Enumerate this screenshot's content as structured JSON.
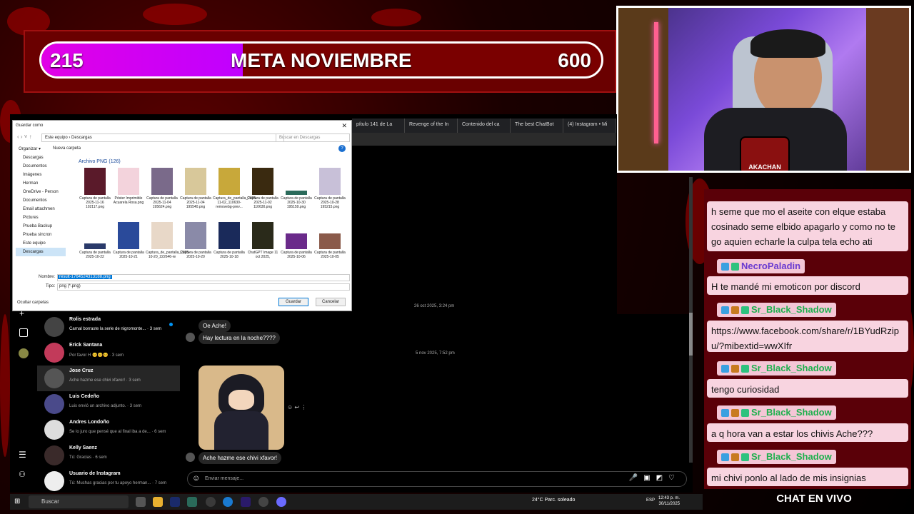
{
  "goal": {
    "current": "215",
    "label": "META NOVIEMBRE",
    "target": "600",
    "progress_fraction": 0.36
  },
  "colors": {
    "goal_fill": "#e100e6",
    "chat_bg": "#5a0008",
    "message_bg": "#f8d4e0",
    "username": "#1db04d"
  },
  "chat": {
    "title": "CHAT EN VIVO",
    "messages": [
      {
        "user": "",
        "text": "h seme que mo el aseite con elque estaba cosinado seme elbido apagarlo y como no te go aquien echarle la culpa tela echo ati"
      },
      {
        "user": "NecroPaladin",
        "text": "H te mandé mi emoticon por discord"
      },
      {
        "user": "Sr_Black_Shadow",
        "text": "https://www.facebook.com/share/r/1BYudRzipu/?mibextid=wwXIfr"
      },
      {
        "user": "Sr_Black_Shadow",
        "text": "tengo curiosidad"
      },
      {
        "user": "Sr_Black_Shadow",
        "text": "a q hora van a estar los chivis Ache???"
      },
      {
        "user": "Sr_Black_Shadow",
        "text": "mi chivi ponlo al lado de mis insignias"
      }
    ]
  },
  "cam": {
    "logo_text": "AKACHAN"
  },
  "browser": {
    "tabs": [
      "pítulo 141 de La",
      "Revenge of the In",
      "Contenido del ca",
      "The best ChatBot",
      "(4) Instagram • Mi"
    ]
  },
  "dialog": {
    "title": "Guardar como",
    "path": "Este equipo › Descargas",
    "search_placeholder": "Buscar en Descargas",
    "organize": "Organizar ▾",
    "new_folder": "Nueva carpeta",
    "sidebar": [
      "Descargas",
      "Documentos",
      "Imágenes",
      "Herman",
      "OneDrive - Person",
      "Documentos",
      "Email attachmen",
      "Pictures",
      "Prueba Backup",
      "Prueba sincron",
      "Este equipo",
      "Descargas"
    ],
    "group_label": "Archivo PNG (126)",
    "files_row1": [
      "Captura de pantalla 2025-11-16 102117.png",
      "Póster Imprimible Acuarela Rosa.png",
      "Captura de pantalla 2025-11-04 195624.png",
      "Captura de pantalla 2025-11-04 195540.png",
      "Captura_de_pantalla_2025-11-02_110630-removebg-prev...",
      "Captura de pantalla 2025-11-02 110630.png",
      "Captura de pantalla 2025-10-30 195159.png",
      "Captura de pantalla 2025-10-28 195215.png"
    ],
    "files_row2": [
      "Captura de pantalla 2025-10-22",
      "Captura de pantalla 2025-10-21",
      "Captura_de_pantalla_2025-10-20_222646-re",
      "Captura de pantalla 2025-10-20",
      "Captura de pantalla 2025-10-18",
      "ChatGPT Image 11 oct 2025,",
      "Captura de pantalla 2025-10-06",
      "Captura de pantalla 2025-10-05"
    ],
    "name_label": "Nombre:",
    "name_value": "result-1764524313188.png",
    "type_label": "Tipo:",
    "type_value": "png (*.png)",
    "hide_folders": "Ocultar carpetas",
    "save": "Guardar",
    "cancel": "Cancelar"
  },
  "instagram": {
    "conversations": [
      {
        "name": "Rolis estrada",
        "preview": "Carnal borraste la serie de nigromonte... · 3 sem"
      },
      {
        "name": "Erick Santana",
        "preview": "Por favor H 😊😊😊 · 3 sem"
      },
      {
        "name": "Jose Cruz",
        "preview": "Ache hazme ese chivi xfavor! · 3 sem"
      },
      {
        "name": "Luis Cedeño",
        "preview": "Luis envió un archivo adjunto. · 3 sem"
      },
      {
        "name": "Andres Londoño",
        "preview": "Se lo juro que pensé que al final iba a de... · 6 sem"
      },
      {
        "name": "Kelly Saenz",
        "preview": "Tú: Gracias · 6 sem"
      },
      {
        "name": "Usuario de Instagram",
        "preview": "Tú: Muchas gracias por tu apoyo herman... · 7 sem"
      }
    ],
    "ts1": "26 oct 2025, 3:24 pm",
    "msg1": "Oe Ache!",
    "msg2": "Hay lectura en la noche????",
    "ts2": "5 nov 2025, 7:52 pm",
    "msg3": "Ache hazme ese chivi xfavor!",
    "compose_placeholder": "Enviar mensaje..."
  },
  "taskbar": {
    "search": "Buscar",
    "weather": "24°C  Parc. soleado",
    "lang": "ESP",
    "time": "12:43 p. m.",
    "date": "30/11/2025"
  }
}
